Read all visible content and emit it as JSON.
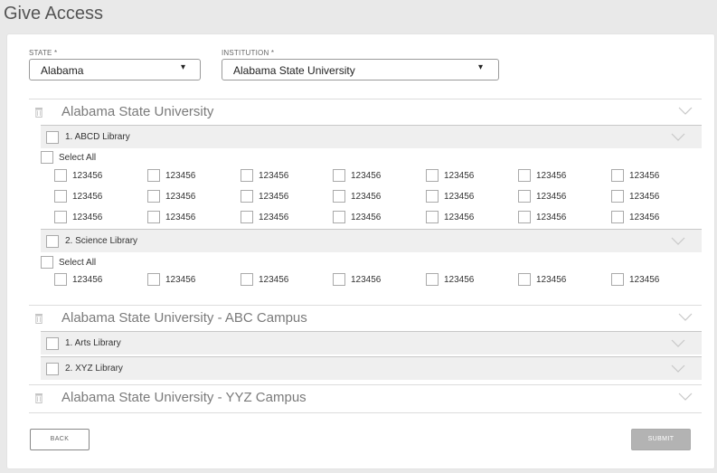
{
  "page": {
    "title": "Give Access"
  },
  "form": {
    "state_label": "STATE *",
    "state_value": "Alabama",
    "institution_label": "INSTITUTION *",
    "institution_value": "Alabama State University"
  },
  "sections": [
    {
      "title": "Alabama State University",
      "libraries": [
        {
          "label": "1. ABCD Library",
          "select_all": "Select All",
          "items": [
            "123456",
            "123456",
            "123456",
            "123456",
            "123456",
            "123456",
            "123456",
            "123456",
            "123456",
            "123456",
            "123456",
            "123456",
            "123456",
            "123456",
            "123456",
            "123456",
            "123456",
            "123456",
            "123456",
            "123456",
            "123456"
          ]
        },
        {
          "label": "2. Science Library",
          "select_all": "Select All",
          "items": [
            "123456",
            "123456",
            "123456",
            "123456",
            "123456",
            "123456",
            "123456"
          ]
        }
      ]
    },
    {
      "title": "Alabama State University - ABC Campus",
      "libraries": [
        {
          "label": "1. Arts Library"
        },
        {
          "label": "2. XYZ Library"
        }
      ]
    },
    {
      "title": "Alabama State University - YYZ Campus",
      "libraries": []
    }
  ],
  "buttons": {
    "back": "BACK",
    "submit": "SUBMIT"
  },
  "icons": {
    "dropdown": "caret-down-icon",
    "expand": "chevron-down-icon",
    "delete": "trash-icon"
  },
  "colors": {
    "submit_bg": "#b3b3b3",
    "library_row_bg": "#efefef"
  }
}
